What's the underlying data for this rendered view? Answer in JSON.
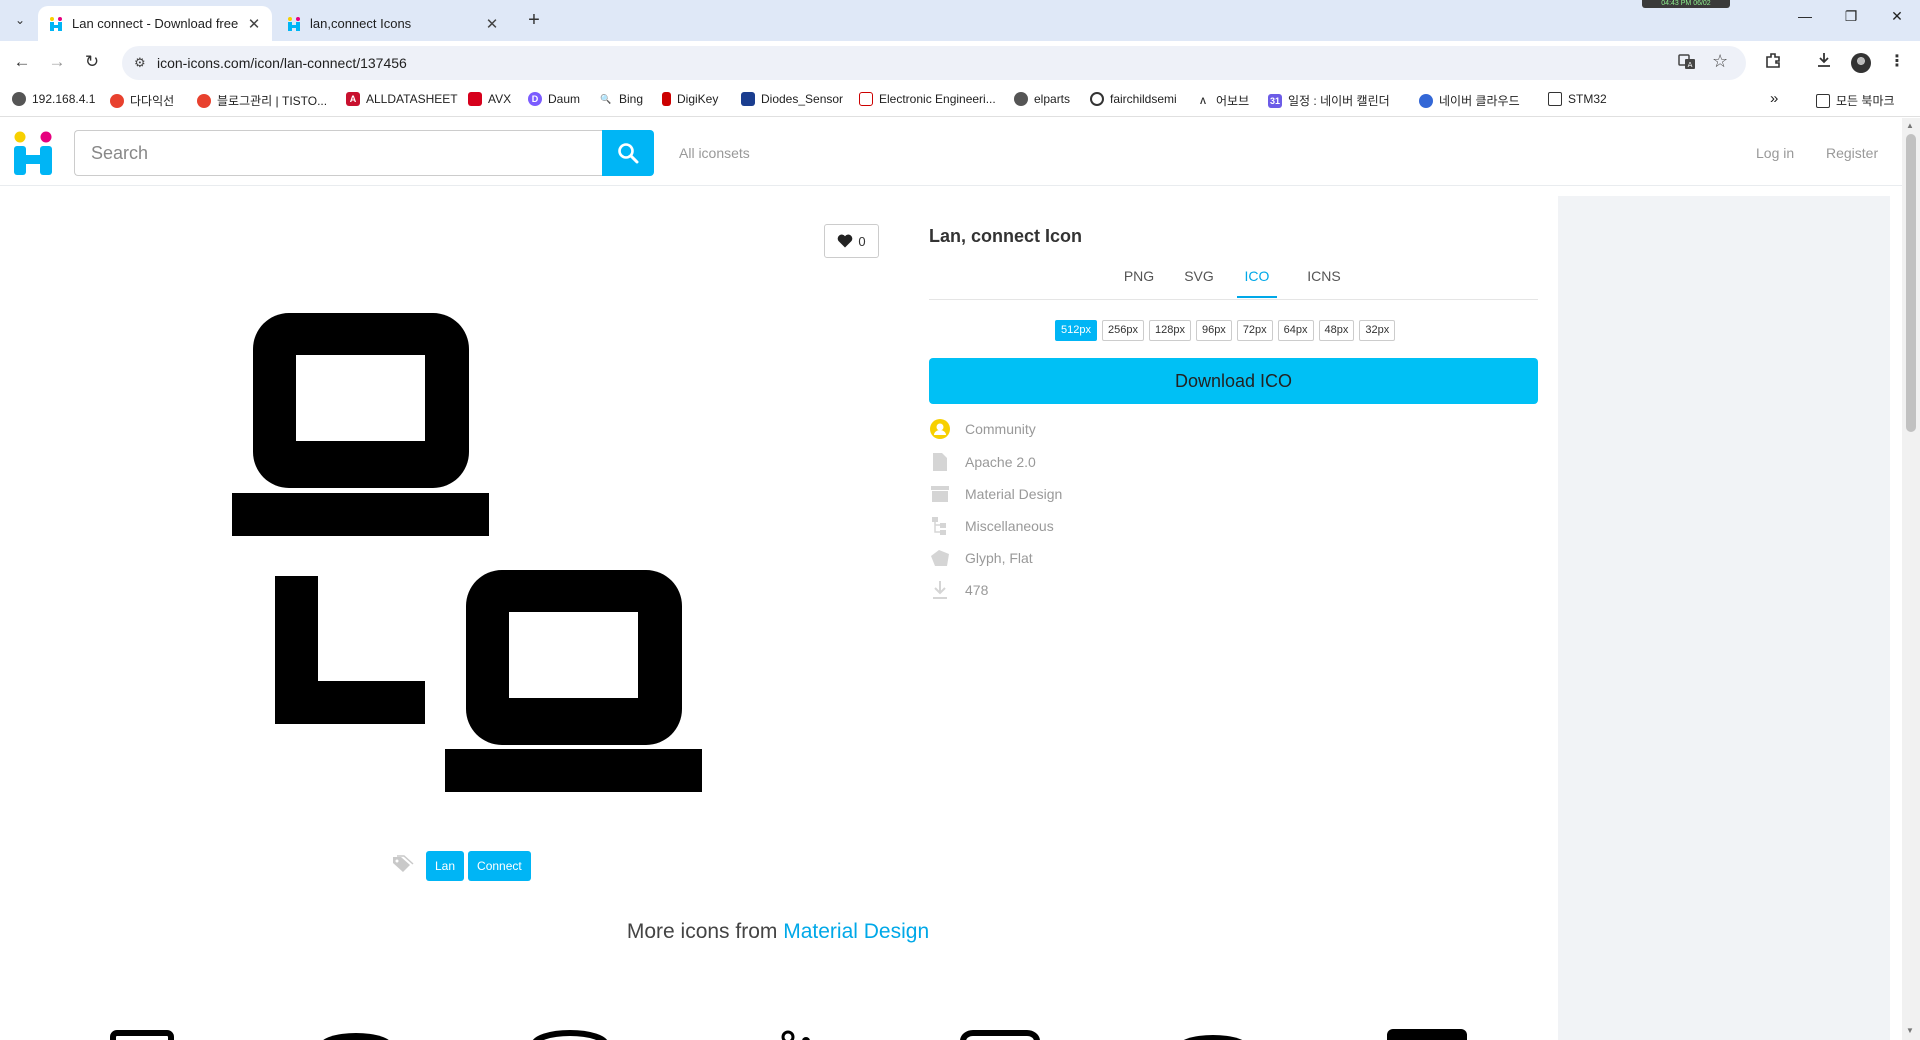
{
  "browser": {
    "tabs": [
      {
        "title": "Lan connect - Download free",
        "active": true
      },
      {
        "title": "lan,connect Icons",
        "active": false
      }
    ],
    "clock": "04:43 PM 06/02",
    "url": "icon-icons.com/icon/lan-connect/137456",
    "bookmarks": [
      {
        "label": "192.168.4.1",
        "icon": "globe-icon"
      },
      {
        "label": "다다익선",
        "icon": "tistory-icon"
      },
      {
        "label": "블로그관리 | TISTO...",
        "icon": "tistory-icon"
      },
      {
        "label": "ALLDATASHEET",
        "icon": "alldatasheet-icon"
      },
      {
        "label": "AVX",
        "icon": "avx-icon"
      },
      {
        "label": "Daum",
        "icon": "daum-icon"
      },
      {
        "label": "Bing",
        "icon": "bing-icon"
      },
      {
        "label": "DigiKey",
        "icon": "digikey-icon"
      },
      {
        "label": "Diodes_Sensor",
        "icon": "diodes-icon"
      },
      {
        "label": "Electronic Engineeri...",
        "icon": "ee-icon"
      },
      {
        "label": "elparts",
        "icon": "globe-icon"
      },
      {
        "label": "fairchildsemi",
        "icon": "fairchild-icon"
      },
      {
        "label": "어보브",
        "icon": "abov-icon"
      },
      {
        "label": "일정 : 네이버 캘린더",
        "icon": "calendar-icon"
      },
      {
        "label": "네이버 클라우드",
        "icon": "cloud-icon"
      },
      {
        "label": "STM32",
        "icon": "folder-icon"
      }
    ],
    "all_bookmarks": "모든 북마크"
  },
  "header": {
    "search_placeholder": "Search",
    "all_iconsets": "All iconsets",
    "login": "Log in",
    "register": "Register"
  },
  "icon": {
    "likes": "0",
    "tags": [
      "Lan",
      "Connect"
    ]
  },
  "panel": {
    "title": "Lan, connect Icon",
    "formats": [
      "PNG",
      "SVG",
      "ICO",
      "ICNS"
    ],
    "active_format": "ICO",
    "sizes": [
      "512px",
      "256px",
      "128px",
      "96px",
      "72px",
      "64px",
      "48px",
      "32px"
    ],
    "active_size": "512px",
    "download_label": "Download ICO",
    "meta": {
      "author": "Community",
      "license": "Apache 2.0",
      "iconset": "Material Design",
      "category": "Miscellaneous",
      "style": "Glyph, Flat",
      "downloads": "478"
    }
  },
  "more": {
    "prefix": "More icons from",
    "link": "Material Design"
  },
  "colors": {
    "accent": "#00b5f5",
    "link": "#00a8e8",
    "tabstrip": "#dfe8f7"
  }
}
